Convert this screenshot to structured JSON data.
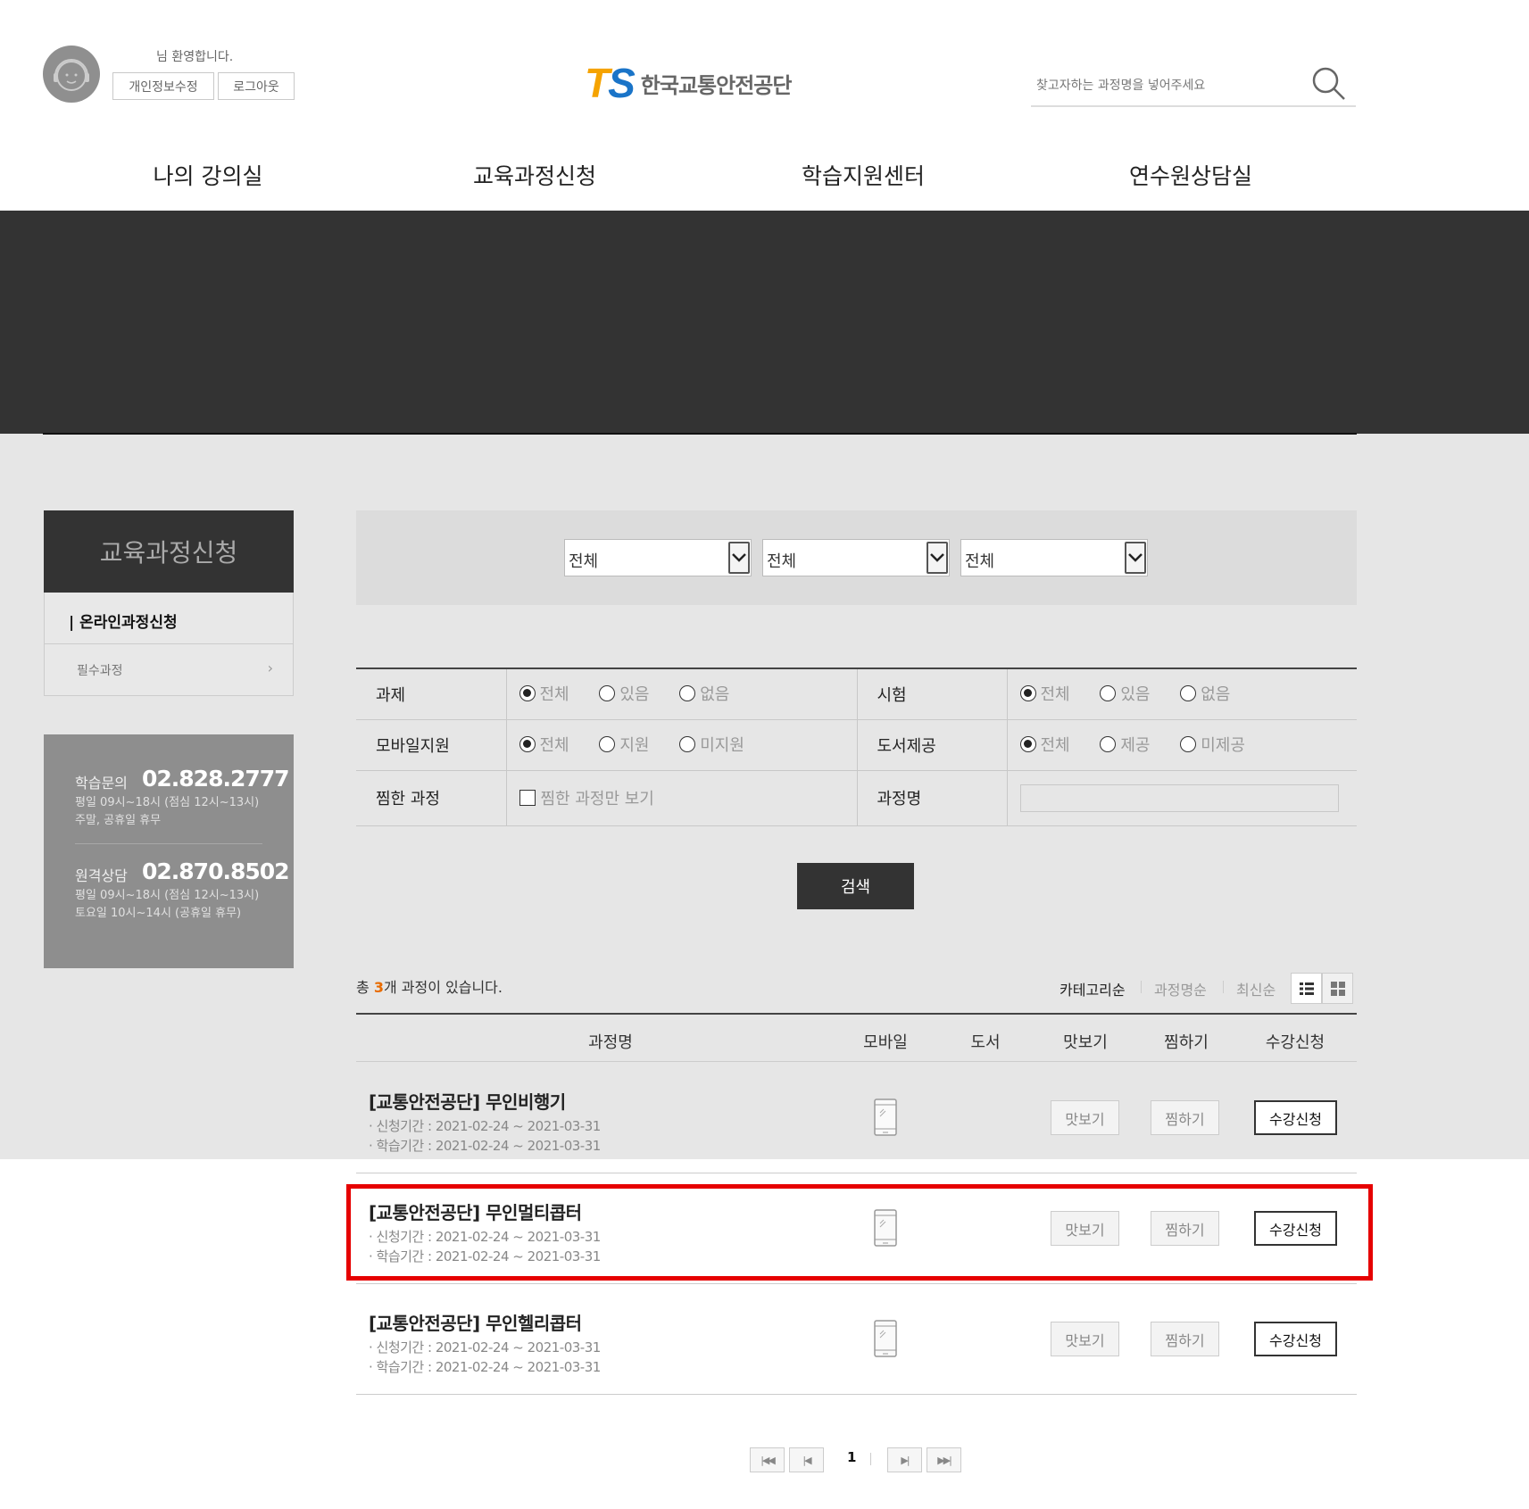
{
  "header": {
    "welcome": "님 환영합니다.",
    "edit_profile": "개인정보수정",
    "logout": "로그아웃",
    "logo_mark_t": "T",
    "logo_mark_s": "S",
    "logo_text": "한국교통안전공단",
    "search_placeholder": "찾고자하는 과정명을 넣어주세요"
  },
  "gnb": [
    "나의 강의실",
    "교육과정신청",
    "학습지원센터",
    "연수원상담실"
  ],
  "sidebar": {
    "title": "교육과정신청",
    "active_item": "| 온라인과정신청",
    "sub_item": "필수과정",
    "contact": {
      "label1": "학습문의",
      "number1": "02.828.2777",
      "note1a": "평일 09시~18시 (점심 12시~13시)",
      "note1b": "주말, 공휴일 휴무",
      "label2": "원격상담",
      "number2": "02.870.8502",
      "note2a": "평일 09시~18시 (점심 12시~13시)",
      "note2b": "토요일 10시~14시 (공휴일 휴무)"
    }
  },
  "filters": {
    "selects": [
      "전체",
      "전체",
      "전체"
    ]
  },
  "search_table": {
    "row1": {
      "label_a": "과제",
      "opts_a": [
        "전체",
        "있음",
        "없음"
      ],
      "label_b": "시험",
      "opts_b": [
        "전체",
        "있음",
        "없음"
      ]
    },
    "row2": {
      "label_a": "모바일지원",
      "opts_a": [
        "전체",
        "지원",
        "미지원"
      ],
      "label_b": "도서제공",
      "opts_b": [
        "전체",
        "제공",
        "미제공"
      ]
    },
    "row3": {
      "label_a": "찜한 과정",
      "check_label": "찜한 과정만 보기",
      "label_b": "과정명",
      "text_value": ""
    },
    "search_button": "검색"
  },
  "list": {
    "total_prefix": "총 ",
    "total_count": "3",
    "total_suffix": "개 과정이 있습니다.",
    "sort": [
      "카테고리순",
      "과정명순",
      "최신순"
    ],
    "columns": [
      "과정명",
      "모바일",
      "도서",
      "맛보기",
      "찜하기",
      "수강신청"
    ],
    "rows": [
      {
        "title": "[교통안전공단] 무인비행기",
        "apply": "· 신청기간 : 2021-02-24 ~ 2021-03-31",
        "study": "· 학습기간 : 2021-02-24 ~ 2021-03-31",
        "preview": "맛보기",
        "wish": "찜하기",
        "enroll": "수강신청"
      },
      {
        "title": "[교통안전공단] 무인멀티콥터",
        "apply": "· 신청기간 : 2021-02-24 ~ 2021-03-31",
        "study": "· 학습기간 : 2021-02-24 ~ 2021-03-31",
        "preview": "맛보기",
        "wish": "찜하기",
        "enroll": "수강신청"
      },
      {
        "title": "[교통안전공단] 무인헬리콥터",
        "apply": "· 신청기간 : 2021-02-24 ~ 2021-03-31",
        "study": "· 학습기간 : 2021-02-24 ~ 2021-03-31",
        "preview": "맛보기",
        "wish": "찜하기",
        "enroll": "수강신청"
      }
    ]
  },
  "pagination": {
    "first": "|◀◀",
    "prev": "|◀",
    "current": "1",
    "next": "▶|",
    "last": "▶▶|"
  },
  "colors": {
    "accent": "#e86b00",
    "highlight": "#e60000",
    "dark": "#333333"
  }
}
